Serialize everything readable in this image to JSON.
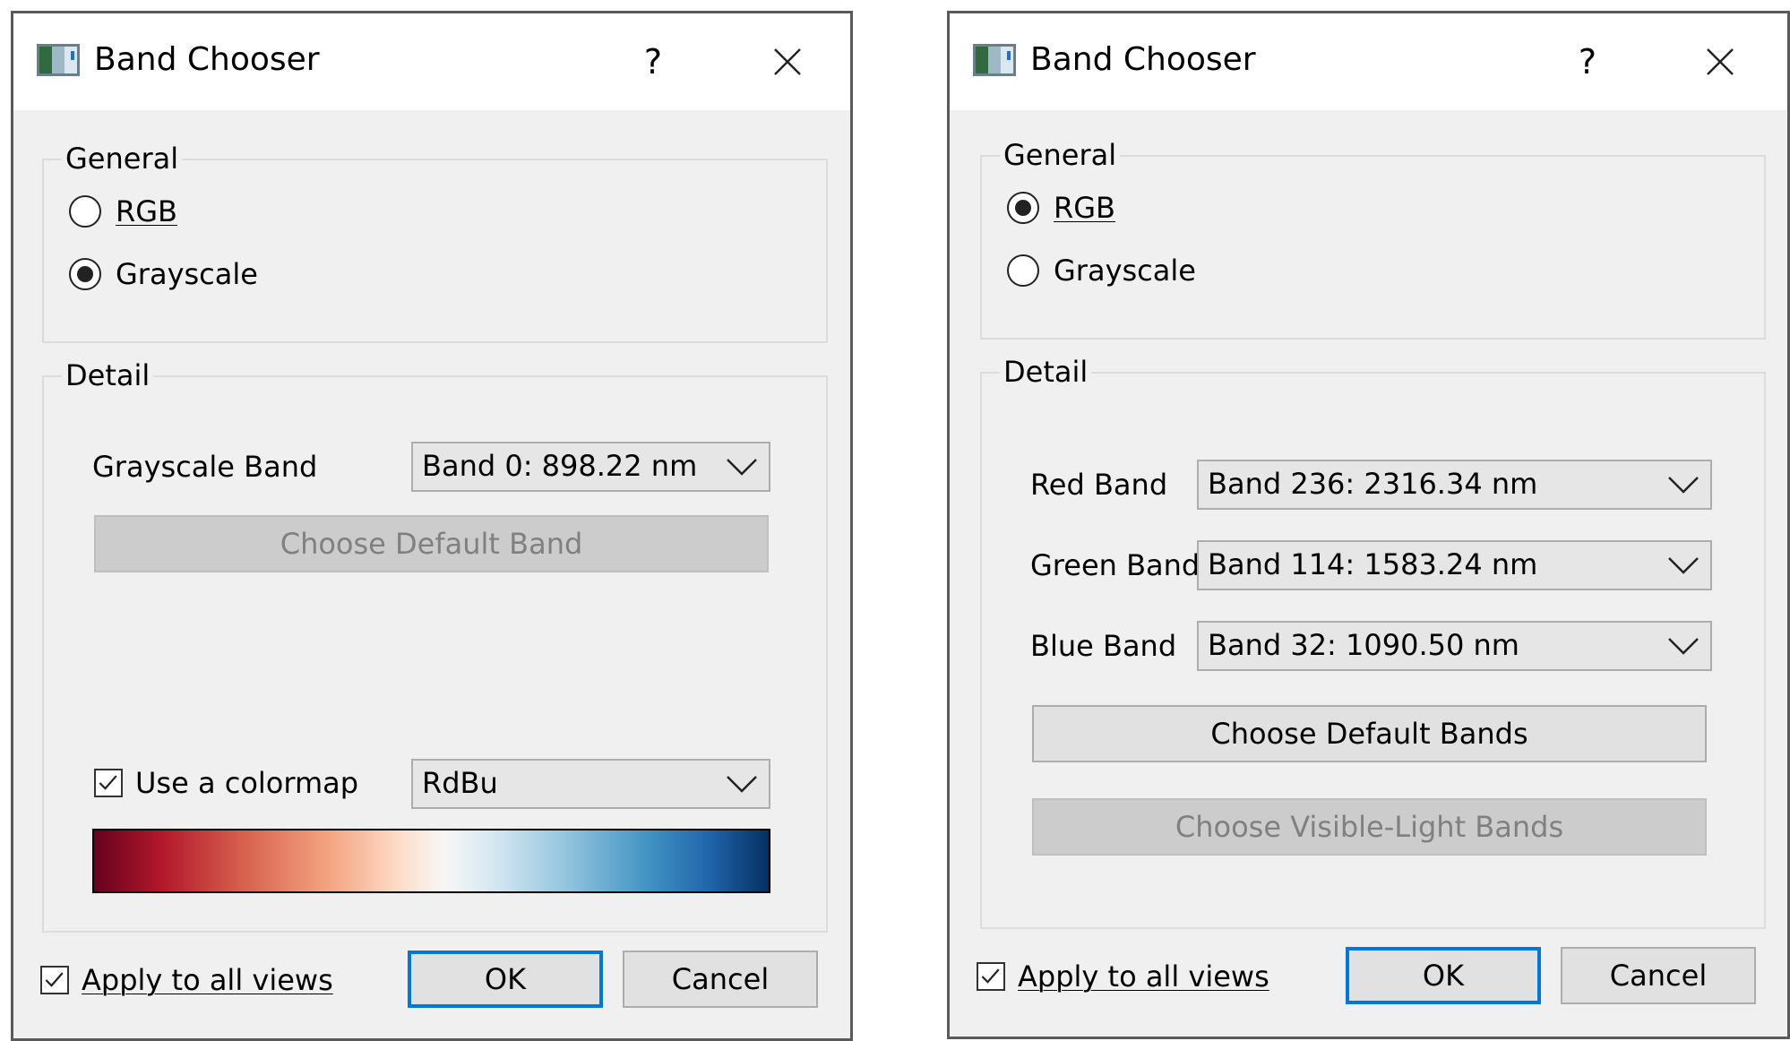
{
  "dialogs": [
    {
      "title": "Band Chooser",
      "help_glyph": "?",
      "general": {
        "title": "General",
        "rgb": {
          "label": "RGB",
          "checked": false
        },
        "grayscale": {
          "label": "Grayscale",
          "checked": true
        }
      },
      "detail": {
        "title": "Detail",
        "grayscale_band_label": "Grayscale Band",
        "grayscale_band_value": "Band 0: 898.22 nm",
        "default_button": "Choose Default Band",
        "colormap_label": "Use a colormap",
        "colormap_checked": true,
        "colormap_value": "RdBu"
      },
      "apply_all_label": "Apply to all views",
      "apply_all_checked": true,
      "ok_label": "OK",
      "cancel_label": "Cancel"
    },
    {
      "title": "Band Chooser",
      "help_glyph": "?",
      "general": {
        "title": "General",
        "rgb": {
          "label": "RGB",
          "checked": true
        },
        "grayscale": {
          "label": "Grayscale",
          "checked": false
        }
      },
      "detail": {
        "title": "Detail",
        "red_label": "Red Band",
        "red_value": "Band 236: 2316.34 nm",
        "green_label": "Green Band",
        "green_value": "Band 114: 1583.24 nm",
        "blue_label": "Blue Band",
        "blue_value": "Band 32: 1090.50 nm",
        "default_button": "Choose Default Bands",
        "visible_button": "Choose Visible-Light Bands"
      },
      "apply_all_label": "Apply to all views",
      "apply_all_checked": true,
      "ok_label": "OK",
      "cancel_label": "Cancel"
    }
  ],
  "icons": {
    "app": "band-chooser-app-icon",
    "close": "close-icon",
    "chevron": "chevron-down-icon",
    "check": "checkmark-icon"
  },
  "colors": {
    "accent": "#0078d7",
    "dialog_bg": "#f0f0f0",
    "disabled_text": "#808080"
  }
}
